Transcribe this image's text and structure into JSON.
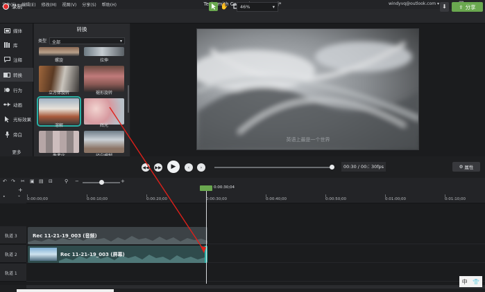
{
  "titlebar": {
    "menus": [
      "文件(F)",
      "编辑(E)",
      "修改(M)",
      "视图(V)",
      "分享(S)",
      "帮助(H)"
    ],
    "title": "TechSmith Camtasia - 2.tscproj*",
    "account": "windyvq@outlook.com ▾",
    "controls": [
      "–",
      "❐",
      "✕"
    ]
  },
  "toolbar": {
    "record_label": "录制",
    "zoom_value": "46%",
    "share_label": "分享"
  },
  "sidebar": {
    "items": [
      {
        "label": "媒体",
        "icon": "media-icon"
      },
      {
        "label": "库",
        "icon": "library-icon"
      },
      {
        "label": "注释",
        "icon": "annotation-icon"
      },
      {
        "label": "转换",
        "icon": "transition-icon",
        "active": true
      },
      {
        "label": "行为",
        "icon": "behavior-icon"
      },
      {
        "label": "动画",
        "icon": "animation-icon"
      },
      {
        "label": "光标效果",
        "icon": "cursor-icon"
      },
      {
        "label": "旁白",
        "icon": "microphone-icon"
      }
    ],
    "more_label": "更多"
  },
  "panel": {
    "title": "转换",
    "type_label": "类型",
    "type_value": "全部",
    "transitions": [
      {
        "label": "螺旋"
      },
      {
        "label": "拉伸"
      },
      {
        "label": "立方体旋转"
      },
      {
        "label": "褪形旋转"
      },
      {
        "label": "溶解"
      },
      {
        "label": "辉光"
      },
      {
        "label": "像素化"
      },
      {
        "label": "径向模糊"
      }
    ]
  },
  "player": {
    "time": "00:30 / 00:30",
    "fps": "30fps",
    "properties_label": "属性",
    "progress_fraction": 1.0
  },
  "timeline": {
    "playhead_time": "0:00:30;04",
    "zoom_fraction": 0.55,
    "ruler": [
      "0:00:00;00",
      "0:00:10;00",
      "0:00:20;00",
      "0:00:30;00",
      "0:00:40;00",
      "0:00:50;00",
      "0:01:00;00",
      "0:01:10;00"
    ],
    "tracks": [
      {
        "name": "轨道 3",
        "clip": "Rec 11-21-19_003 (音频)"
      },
      {
        "name": "轨道 2",
        "clip": "Rec 11-21-19_003 (屏幕)"
      },
      {
        "name": "轨道 1",
        "clip": ""
      }
    ]
  },
  "preview": {
    "watermark_text": "英语上最是一个世界"
  },
  "ime": {
    "label": "中"
  },
  "colors": {
    "accent": "#6aa84f",
    "record": "#e02b2b",
    "selection": "#2bb1a6",
    "arrow": "#e0201a"
  }
}
